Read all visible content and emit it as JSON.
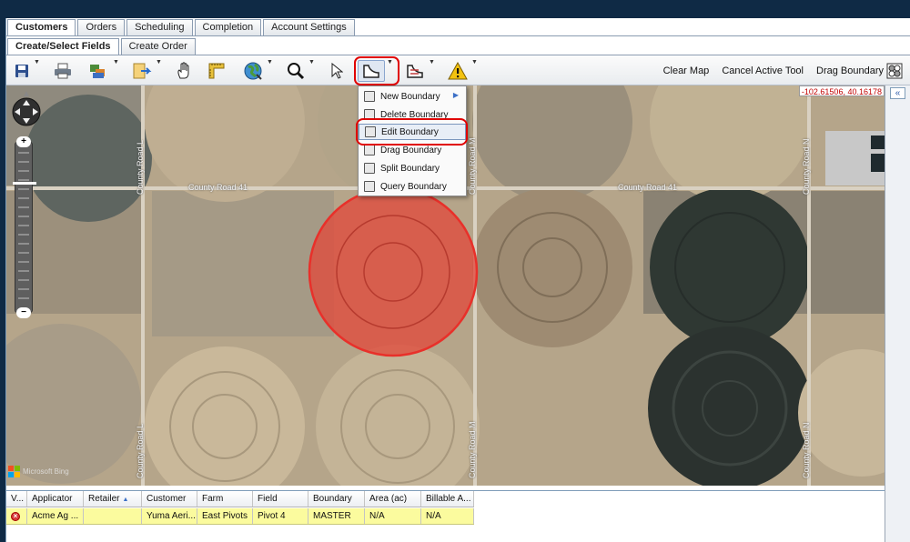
{
  "main_tabs": [
    {
      "label": "Customers",
      "active": true
    },
    {
      "label": "Orders",
      "active": false
    },
    {
      "label": "Scheduling",
      "active": false
    },
    {
      "label": "Completion",
      "active": false
    },
    {
      "label": "Account Settings",
      "active": false
    }
  ],
  "sub_tabs": [
    {
      "label": "Create/Select Fields",
      "active": true
    },
    {
      "label": "Create Order",
      "active": false
    }
  ],
  "toolbar": {
    "tools": [
      "save-icon",
      "print-icon",
      "layers-icon",
      "export-icon",
      "pan-hand-icon",
      "measure-ruler-icon",
      "globe-icon",
      "zoom-magnifier-icon",
      "select-arrow-icon",
      "boundary-tool-icon",
      "boundary-edit-icon",
      "warning-icon"
    ],
    "clear_map": "Clear Map",
    "cancel_tool": "Cancel Active Tool",
    "drag_boundary": "Drag Boundary"
  },
  "map": {
    "coordinates": "-102.61506, 40.16178",
    "roads": {
      "county_road_41": "County Road 41",
      "county_road_l": "County Road L",
      "county_road_m": "County Road M",
      "county_road_n": "County Road N"
    },
    "watermark": "Microsoft Bing"
  },
  "boundary_menu": {
    "items": [
      {
        "label": "New Boundary",
        "submenu": true,
        "selected": false
      },
      {
        "label": "Delete Boundary",
        "submenu": false,
        "selected": false
      },
      {
        "label": "Edit Boundary",
        "submenu": false,
        "selected": true
      },
      {
        "label": "Drag Boundary",
        "submenu": false,
        "selected": false
      },
      {
        "label": "Split Boundary",
        "submenu": false,
        "selected": false
      },
      {
        "label": "Query Boundary",
        "submenu": false,
        "selected": false
      }
    ]
  },
  "grid": {
    "columns": [
      "V...",
      "Applicator",
      "Retailer",
      "Customer",
      "Farm",
      "Field",
      "Boundary",
      "Area (ac)",
      "Billable A..."
    ],
    "sorted_column": "Retailer",
    "rows": [
      {
        "applicator": "Acme Ag ...",
        "retailer": "",
        "customer": "Yuma Aeri...",
        "farm": "East Pivots",
        "field": "Pivot 4",
        "boundary": "MASTER",
        "area": "N/A",
        "billable": "N/A",
        "status": "error"
      }
    ]
  },
  "colors": {
    "highlight_red": "#e00000",
    "selected_row": "#fbfb9e",
    "field_overlay": "#e04a3c"
  }
}
